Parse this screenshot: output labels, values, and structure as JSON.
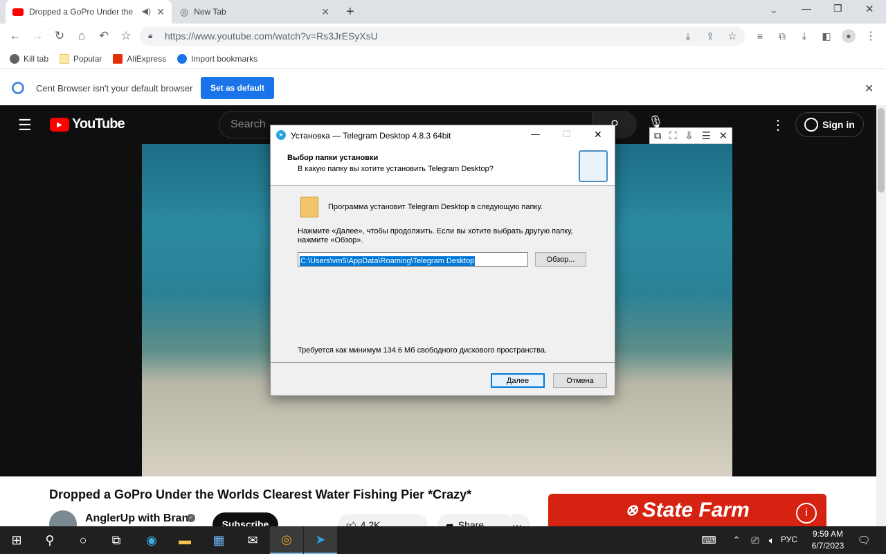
{
  "browser": {
    "tabs": [
      {
        "title": "Dropped a GoPro Under the",
        "active": true
      },
      {
        "title": "New Tab",
        "active": false
      }
    ],
    "url": "https://www.youtube.com/watch?v=Rs3JrESyXsU",
    "bookmarks": [
      "Kill tab",
      "Popular",
      "AliExpress",
      "Import bookmarks"
    ],
    "infobar": {
      "message": "Cent Browser isn't your default browser",
      "button": "Set as default"
    }
  },
  "youtube": {
    "logo": "YouTube",
    "search_placeholder": "Search",
    "sign_in": "Sign in",
    "video_title": "Dropped a GoPro Under the Worlds Clearest Water Fishing Pier *Crazy*",
    "channel": "AnglerUp with Brant",
    "subscribe": "Subscribe",
    "likes": "4.2K",
    "share": "Share",
    "ad_brand": "State Farm"
  },
  "dialog": {
    "title": "Установка — Telegram Desktop 4.8.3 64bit",
    "heading": "Выбор папки установки",
    "subheading": "В какую папку вы хотите установить Telegram Desktop?",
    "info": "Программа установит Telegram Desktop в следующую папку.",
    "instructions_1": "Нажмите «Далее», чтобы продолжить. Если вы хотите выбрать другую папку,",
    "instructions_2": "нажмите «Обзор».",
    "path": "C:\\Users\\vm5\\AppData\\Roaming\\Telegram Desktop",
    "browse": "Обзор...",
    "space": "Требуется как минимум 134.6 Мб свободного дискового пространства.",
    "next": "Далее",
    "cancel": "Отмена"
  },
  "taskbar": {
    "lang": "РУС",
    "time": "9:59 AM",
    "date": "6/7/2023"
  }
}
